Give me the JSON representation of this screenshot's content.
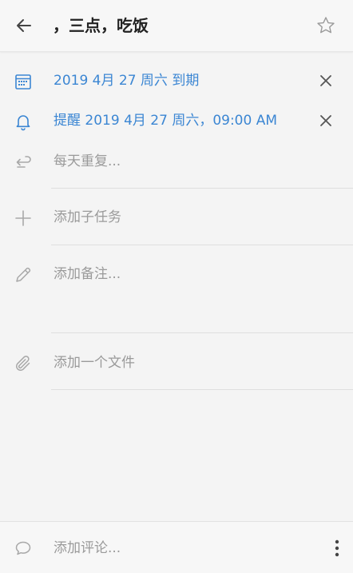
{
  "header": {
    "title": "，三点，吃饭",
    "back_icon": "arrow-left-icon",
    "star_icon": "star-outline-icon"
  },
  "due": {
    "icon": "calendar-icon",
    "label": "2019 4月 27 周六 到期",
    "close_icon": "close-icon"
  },
  "reminder": {
    "icon": "bell-icon",
    "label": "提醒 2019 4月 27 周六，09:00 AM",
    "close_icon": "close-icon"
  },
  "repeat": {
    "icon": "repeat-icon",
    "label": "每天重复..."
  },
  "subtask": {
    "icon": "plus-icon",
    "label": "添加子任务"
  },
  "note": {
    "icon": "pencil-icon",
    "label": "添加备注..."
  },
  "file": {
    "icon": "paperclip-icon",
    "label": "添加一个文件"
  },
  "footer": {
    "icon": "comment-icon",
    "label": "添加评论...",
    "more_icon": "more-vertical-icon"
  },
  "colors": {
    "accent": "#3b86d3",
    "muted": "#9a9a9a",
    "background": "#f4f4f4"
  }
}
